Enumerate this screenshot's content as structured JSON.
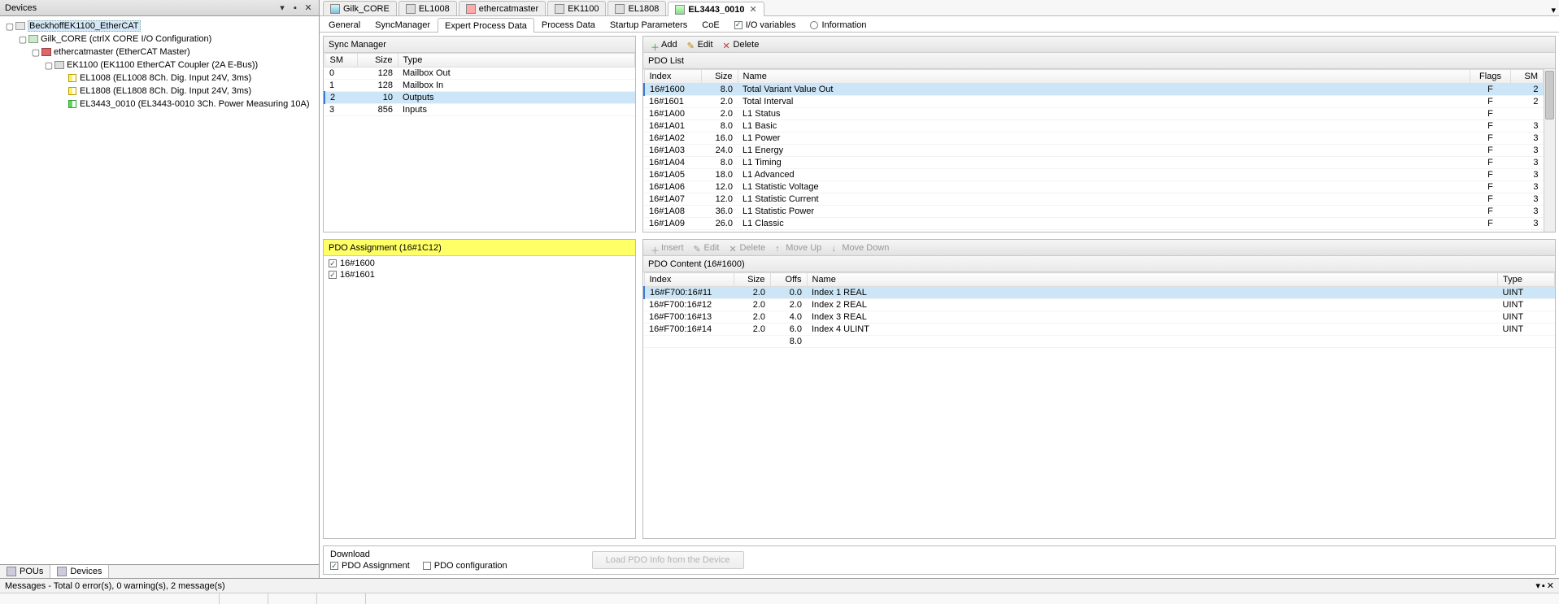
{
  "left_panel": {
    "title": "Devices",
    "tree": {
      "root": "BeckhoffEK1100_EtherCAT",
      "gilk": "Gilk_CORE (ctrlX CORE I/O Configuration)",
      "master": "ethercatmaster (EtherCAT Master)",
      "coupler": "EK1100 (EK1100 EtherCAT Coupler (2A E-Bus))",
      "slaves": [
        "EL1008 (EL1008 8Ch. Dig. Input 24V, 3ms)",
        "EL1808 (EL1808 8Ch. Dig. Input 24V, 3ms)",
        "EL3443_0010 (EL3443-0010 3Ch. Power Measuring 10A)"
      ]
    },
    "bottom_tabs": {
      "pous": "POUs",
      "devices": "Devices"
    }
  },
  "doc_tabs": [
    {
      "label": "Gilk_CORE"
    },
    {
      "label": "EL1008"
    },
    {
      "label": "ethercatmaster"
    },
    {
      "label": "EK1100"
    },
    {
      "label": "EL1808"
    },
    {
      "label": "EL3443_0010",
      "active": true
    }
  ],
  "sub_tabs": {
    "general": "General",
    "syncmanager": "SyncManager",
    "expert": "Expert Process Data",
    "process": "Process Data",
    "startup": "Startup Parameters",
    "coe": "CoE",
    "iovars": "I/O variables",
    "info": "Information"
  },
  "sync_manager": {
    "title": "Sync Manager",
    "h": {
      "sm": "SM",
      "size": "Size",
      "type": "Type"
    },
    "rows": [
      {
        "sm": "0",
        "size": "128",
        "type": "Mailbox Out"
      },
      {
        "sm": "1",
        "size": "128",
        "type": "Mailbox In"
      },
      {
        "sm": "2",
        "size": "10",
        "type": "Outputs",
        "sel": true
      },
      {
        "sm": "3",
        "size": "856",
        "type": "Inputs"
      }
    ]
  },
  "pdo_list": {
    "title": "PDO List",
    "tb": {
      "add": "Add",
      "edit": "Edit",
      "delete": "Delete"
    },
    "h": {
      "index": "Index",
      "size": "Size",
      "name": "Name",
      "flags": "Flags",
      "sm": "SM"
    },
    "rows": [
      {
        "index": "16#1600",
        "size": "8.0",
        "name": "Total Variant Value Out",
        "flags": "F",
        "sm": "2",
        "sel": true
      },
      {
        "index": "16#1601",
        "size": "2.0",
        "name": "Total Interval",
        "flags": "F",
        "sm": "2"
      },
      {
        "index": "16#1A00",
        "size": "2.0",
        "name": "L1 Status",
        "flags": "F",
        "sm": ""
      },
      {
        "index": "16#1A01",
        "size": "8.0",
        "name": "L1 Basic",
        "flags": "F",
        "sm": "3"
      },
      {
        "index": "16#1A02",
        "size": "16.0",
        "name": "L1 Power",
        "flags": "F",
        "sm": "3"
      },
      {
        "index": "16#1A03",
        "size": "24.0",
        "name": "L1 Energy",
        "flags": "F",
        "sm": "3"
      },
      {
        "index": "16#1A04",
        "size": "8.0",
        "name": "L1 Timing",
        "flags": "F",
        "sm": "3"
      },
      {
        "index": "16#1A05",
        "size": "18.0",
        "name": "L1 Advanced",
        "flags": "F",
        "sm": "3"
      },
      {
        "index": "16#1A06",
        "size": "12.0",
        "name": "L1 Statistic Voltage",
        "flags": "F",
        "sm": "3"
      },
      {
        "index": "16#1A07",
        "size": "12.0",
        "name": "L1 Statistic Current",
        "flags": "F",
        "sm": "3"
      },
      {
        "index": "16#1A08",
        "size": "36.0",
        "name": "L1 Statistic Power",
        "flags": "F",
        "sm": "3"
      },
      {
        "index": "16#1A09",
        "size": "26.0",
        "name": "L1 Classic",
        "flags": "F",
        "sm": "3"
      }
    ]
  },
  "pdo_assign": {
    "title": "PDO Assignment (16#1C12)",
    "items": [
      "16#1600",
      "16#1601"
    ]
  },
  "pdo_content": {
    "title": "PDO Content (16#1600)",
    "tb": {
      "insert": "Insert",
      "edit": "Edit",
      "delete": "Delete",
      "moveup": "Move Up",
      "movedown": "Move Down"
    },
    "h": {
      "index": "Index",
      "size": "Size",
      "offs": "Offs",
      "name": "Name",
      "type": "Type"
    },
    "rows": [
      {
        "index": "16#F700:16#11",
        "size": "2.0",
        "offs": "0.0",
        "name": "Index 1 REAL",
        "type": "UINT",
        "sel": true
      },
      {
        "index": "16#F700:16#12",
        "size": "2.0",
        "offs": "2.0",
        "name": "Index 2 REAL",
        "type": "UINT"
      },
      {
        "index": "16#F700:16#13",
        "size": "2.0",
        "offs": "4.0",
        "name": "Index 3 REAL",
        "type": "UINT"
      },
      {
        "index": "16#F700:16#14",
        "size": "2.0",
        "offs": "6.0",
        "name": "Index 4 ULINT",
        "type": "UINT"
      },
      {
        "index": "",
        "size": "",
        "offs": "8.0",
        "name": "",
        "type": ""
      }
    ]
  },
  "download": {
    "title": "Download",
    "pdo_assignment": "PDO Assignment",
    "pdo_configuration": "PDO configuration",
    "load_btn": "Load PDO Info from the Device"
  },
  "messages": "Messages - Total 0 error(s), 0 warning(s), 2 message(s)"
}
